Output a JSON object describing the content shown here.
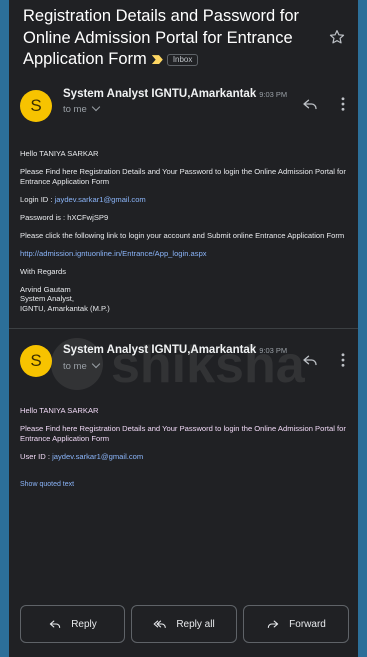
{
  "email": {
    "subject": "Registration Details and Password for Online Admission Portal for Entrance Application Form",
    "inbox_label": "Inbox",
    "icons": {
      "important": "important-marker-icon",
      "star": "star-icon",
      "reply": "reply-icon",
      "more": "more-vert-icon"
    }
  },
  "messages": [
    {
      "avatar_letter": "S",
      "sender": "System Analyst IGNTU,Amarkantak",
      "time": "9:03 PM",
      "to": "to me",
      "greeting": "Hello TANIYA SARKAR",
      "intro": "Please Find here Registration Details and Your Password to login the Online Admission Portal for Entrance Application Form",
      "login_label": "Login ID : ",
      "login_id": "jaydev.sarkar1@gmail.com",
      "password_line": "Password is : hXCFwjSP9",
      "instruction": "Please click the following link to login your account and Submit online Entrance Application Form",
      "link": "http://admission.igntuonline.in/Entrance/App_login.aspx",
      "regards": "With Regards",
      "signature_name": "Arvind Gautam",
      "signature_title": "System Analyst,",
      "signature_org": "IGNTU, Amarkantak (M.P.)"
    },
    {
      "avatar_letter": "S",
      "sender": "System Analyst IGNTU,Amarkantak",
      "time": "9:03 PM",
      "to": "to me",
      "greeting": "Hello TANIYA SARKAR",
      "intro": "Please Find here Registration Details and Your Password to login the Online Admission Portal for Entrance Application Form",
      "user_label": "User ID : ",
      "user_id": "jaydev.sarkar1@gmail.com",
      "show_quoted": "Show quoted text"
    }
  ],
  "actions": {
    "reply": "Reply",
    "reply_all": "Reply all",
    "forward": "Forward"
  },
  "colors": {
    "background": "#202124",
    "frame": "#2c6f99",
    "avatar": "#f7c300",
    "link": "#8ab4f8",
    "important": "#fdd663"
  },
  "watermark": "shiksha"
}
